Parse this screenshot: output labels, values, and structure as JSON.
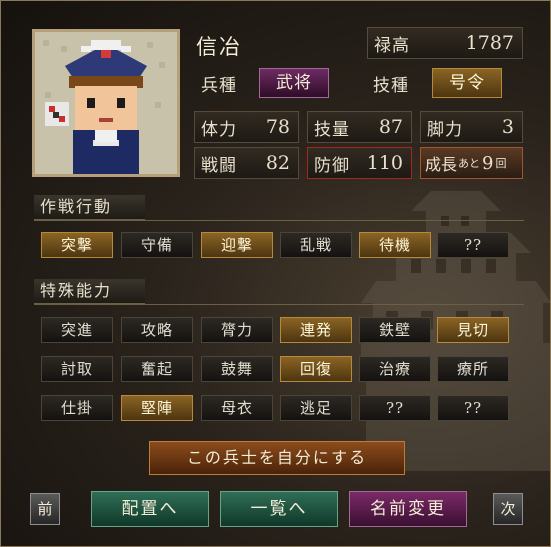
{
  "unit": {
    "name": "信冶",
    "salary_label": "禄高",
    "salary_value": "1787",
    "type_label": "兵種",
    "type_value": "武将",
    "skill_label": "技種",
    "skill_value": "号令"
  },
  "stats": {
    "hp_label": "体力",
    "hp_value": "78",
    "tech_label": "技量",
    "tech_value": "87",
    "leg_label": "脚力",
    "leg_value": "3",
    "battle_label": "戦闘",
    "battle_value": "82",
    "defense_label": "防御",
    "defense_value": "110",
    "growth_prefix": "成長",
    "growth_ato": "あと",
    "growth_value": "9",
    "growth_unit": "回"
  },
  "tactics": {
    "title": "作戦行動",
    "items": [
      {
        "label": "突撃",
        "active": true
      },
      {
        "label": "守備",
        "active": false
      },
      {
        "label": "迎撃",
        "active": true
      },
      {
        "label": "乱戦",
        "active": false
      },
      {
        "label": "待機",
        "active": true
      },
      {
        "label": "??",
        "active": false
      }
    ]
  },
  "abilities": {
    "title": "特殊能力",
    "items": [
      {
        "label": "突進",
        "active": false
      },
      {
        "label": "攻略",
        "active": false
      },
      {
        "label": "膂力",
        "active": false
      },
      {
        "label": "連発",
        "active": true
      },
      {
        "label": "鉄壁",
        "active": false
      },
      {
        "label": "見切",
        "active": true
      },
      {
        "label": "討取",
        "active": false
      },
      {
        "label": "奮起",
        "active": false
      },
      {
        "label": "鼓舞",
        "active": false
      },
      {
        "label": "回復",
        "active": true
      },
      {
        "label": "治療",
        "active": false
      },
      {
        "label": "療所",
        "active": false
      },
      {
        "label": "仕掛",
        "active": false
      },
      {
        "label": "堅陣",
        "active": true
      },
      {
        "label": "母衣",
        "active": false
      },
      {
        "label": "逃足",
        "active": false
      },
      {
        "label": "??",
        "active": false
      },
      {
        "label": "??",
        "active": false
      }
    ]
  },
  "actions": {
    "make_mine": "この兵士を自分にする",
    "prev": "前",
    "deploy": "配置へ",
    "list": "一覧へ",
    "rename": "名前変更",
    "next": "次"
  },
  "colors": {
    "active_chip": "#8a6424",
    "green_button": "#2f6e57",
    "purple_button": "#7b2a68",
    "orange_button": "#8c4c1c"
  }
}
